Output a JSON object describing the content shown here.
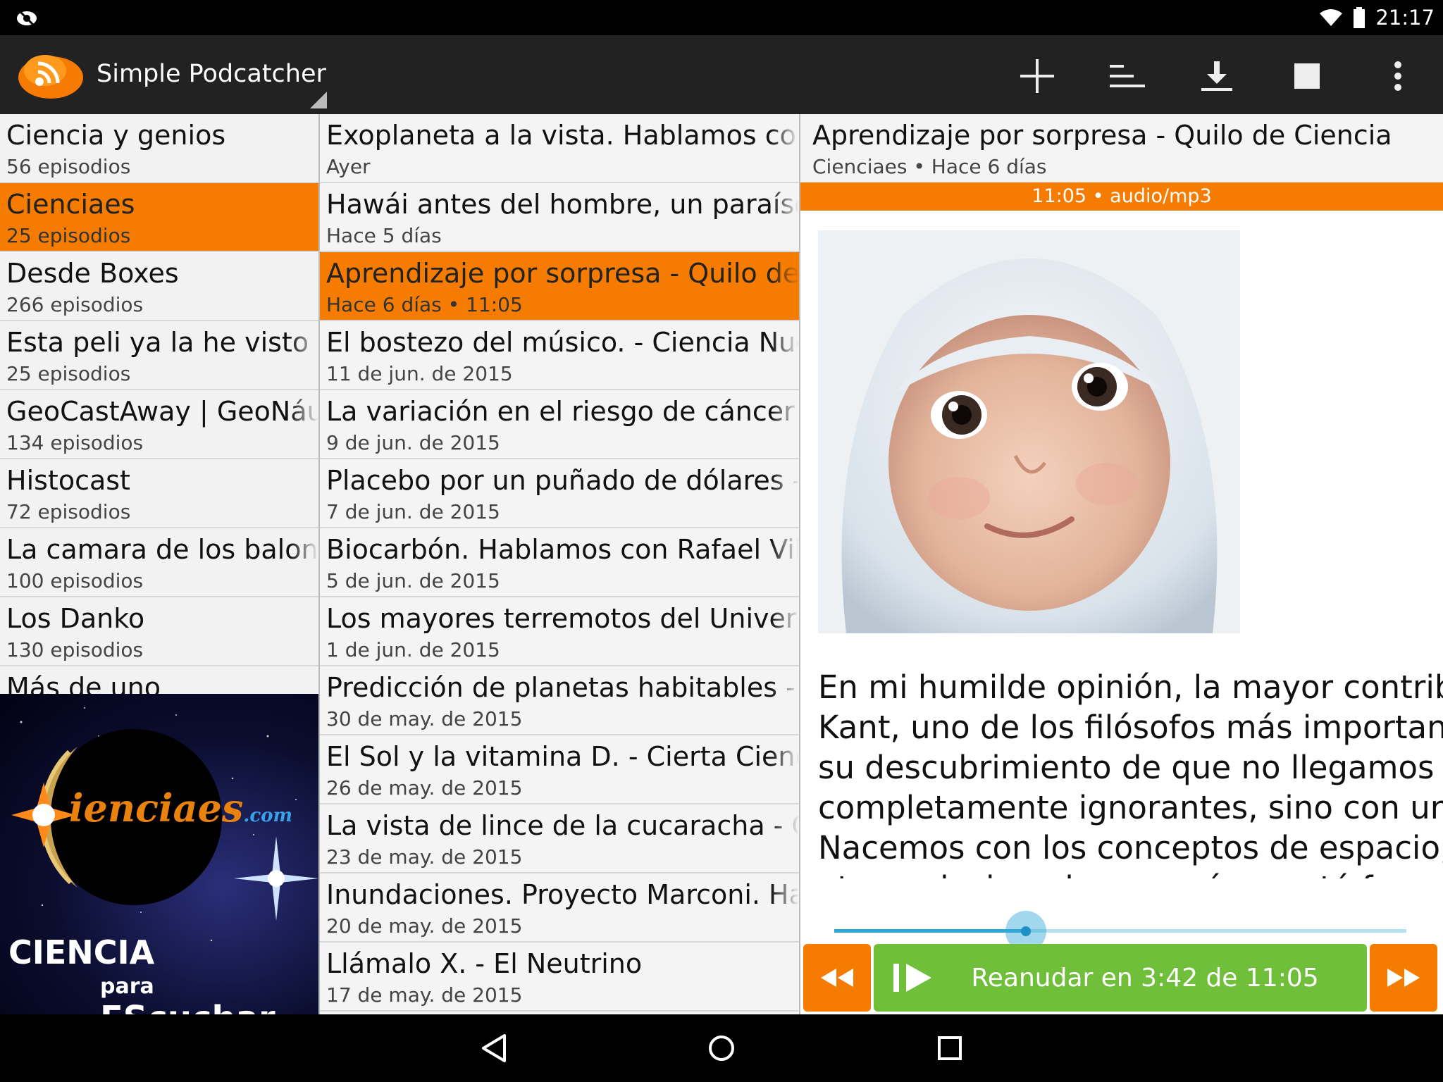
{
  "status_bar": {
    "time": "21:17",
    "left_icon": "cast-icon",
    "right_icons": [
      "wifi-icon",
      "battery-icon"
    ]
  },
  "app": {
    "title": "Simple Podcatcher",
    "actions": [
      "add-icon",
      "sort-icon",
      "download-icon",
      "stop-icon",
      "overflow-menu-icon"
    ]
  },
  "podcasts": [
    {
      "title": "Ciencia y genios",
      "subtitle": "56 episodios",
      "selected": false
    },
    {
      "title": "Cienciaes",
      "subtitle": "25 episodios",
      "selected": true
    },
    {
      "title": "Desde Boxes",
      "subtitle": "266 episodios",
      "selected": false
    },
    {
      "title": "Esta peli ya la he visto",
      "subtitle": "25 episodios",
      "selected": false
    },
    {
      "title": "GeoCastAway | GeoNáufragos",
      "subtitle": "134 episodios",
      "selected": false
    },
    {
      "title": "Histocast",
      "subtitle": "72 episodios",
      "selected": false
    },
    {
      "title": "La camara de los balones",
      "subtitle": "100 episodios",
      "selected": false
    },
    {
      "title": "Los Danko",
      "subtitle": "130 episodios",
      "selected": false
    },
    {
      "title": "Más de uno",
      "subtitle": "",
      "selected": false
    }
  ],
  "podcast_art": {
    "logo_text_1": "ienciaes",
    "logo_text_2": ".com",
    "tagline_1": "CIENCIA",
    "tagline_2": "para",
    "tagline_3": "EScuchar"
  },
  "episodes": [
    {
      "title": "Exoplaneta a la vista. Hablamos con Ignasi Ribas",
      "subtitle": "Ayer",
      "selected": false
    },
    {
      "title": "Hawái antes del hombre, un paraíso perdido",
      "subtitle": "Hace 5 días",
      "selected": false
    },
    {
      "title": "Aprendizaje por sorpresa - Quilo de Ciencia",
      "subtitle": "Hace 6 días • 11:05",
      "selected": true
    },
    {
      "title": "El bostezo del músico. - Ciencia Nuestra",
      "subtitle": "11 de jun. de 2015",
      "selected": false
    },
    {
      "title": "La variación en el riesgo de cáncer por tejidos",
      "subtitle": "9 de jun. de 2015",
      "selected": false
    },
    {
      "title": "Placebo por un puñado de dólares - Quilo",
      "subtitle": "7 de jun. de 2015",
      "selected": false
    },
    {
      "title": "Biocarbón. Hablamos con Rafael Villaseñor",
      "subtitle": "5 de jun. de 2015",
      "selected": false
    },
    {
      "title": "Los mayores terremotos del Universo",
      "subtitle": "1 de jun. de 2015",
      "selected": false
    },
    {
      "title": "Predicción de planetas habitables - Quilo",
      "subtitle": "30 de may. de 2015",
      "selected": false
    },
    {
      "title": "El Sol y la vitamina D. - Cierta Ciencia",
      "subtitle": "26 de may. de 2015",
      "selected": false
    },
    {
      "title": "La vista de lince de la cucaracha - Quilo",
      "subtitle": "23 de may. de 2015",
      "selected": false
    },
    {
      "title": "Inundaciones. Proyecto Marconi. Hablamos",
      "subtitle": "20 de may. de 2015",
      "selected": false
    },
    {
      "title": "Llámalo X. - El Neutrino",
      "subtitle": "17 de may. de 2015",
      "selected": false
    }
  ],
  "detail": {
    "title": "Aprendizaje por sorpresa - Quilo de Ciencia",
    "subtitle": "Cienciaes • Hace 6 días",
    "meta": "11:05 • audio/mp3",
    "description_lines": [
      "En mi humilde opinión, la mayor contribución de",
      "Kant, uno de los filósofos más importantes, fue",
      "su descubrimiento de que no llegamos al mundo",
      "completamente ignorantes, sino con un conjunto",
      "Nacemos con los conceptos de espacio, de tiempo",
      "otros relacionados con cómo está formado"
    ],
    "progress": 0.335,
    "play_label": "Reanudar en 3:42 de 11:05"
  },
  "colors": {
    "accent": "#f57c00",
    "play": "#6fbf3a",
    "seek": "#2ea8d8"
  }
}
